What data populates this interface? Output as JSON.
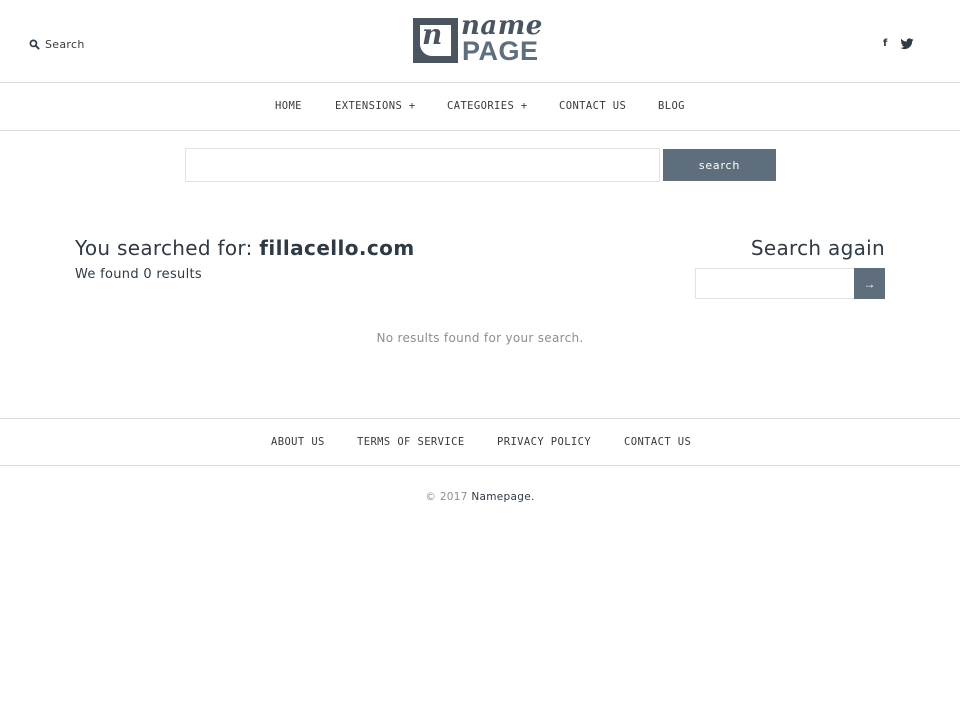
{
  "header": {
    "search_label": "Search",
    "logo": {
      "line1": "name",
      "line2": "PAGE",
      "mark_letter": "n"
    },
    "social": {
      "facebook_glyph": "f",
      "twitter_icon": "twitter-icon"
    }
  },
  "nav": {
    "items": [
      {
        "label": "HOME"
      },
      {
        "label": "EXTENSIONS +"
      },
      {
        "label": "CATEGORIES +"
      },
      {
        "label": "CONTACT US"
      },
      {
        "label": "BLOG"
      }
    ]
  },
  "search": {
    "input_value": "",
    "button_label": "search"
  },
  "results": {
    "prefix": "You searched for:",
    "query": "fillacello.com",
    "count_text": "We found 0 results",
    "empty_message": "No results found for your search."
  },
  "search_again": {
    "title": "Search again",
    "input_value": "",
    "button_label": "→"
  },
  "footer": {
    "links": [
      {
        "label": "ABOUT US"
      },
      {
        "label": "TERMS OF SERVICE"
      },
      {
        "label": "PRIVACY POLICY"
      },
      {
        "label": "CONTACT US"
      }
    ],
    "copyright_prefix": "© 2017",
    "brand": "Namepage."
  },
  "colors": {
    "accent": "#5e6e7c",
    "logo_dark": "#4a5560",
    "text": "#2f3a45",
    "muted": "#8e8e8e",
    "border": "#dcdcdc"
  }
}
